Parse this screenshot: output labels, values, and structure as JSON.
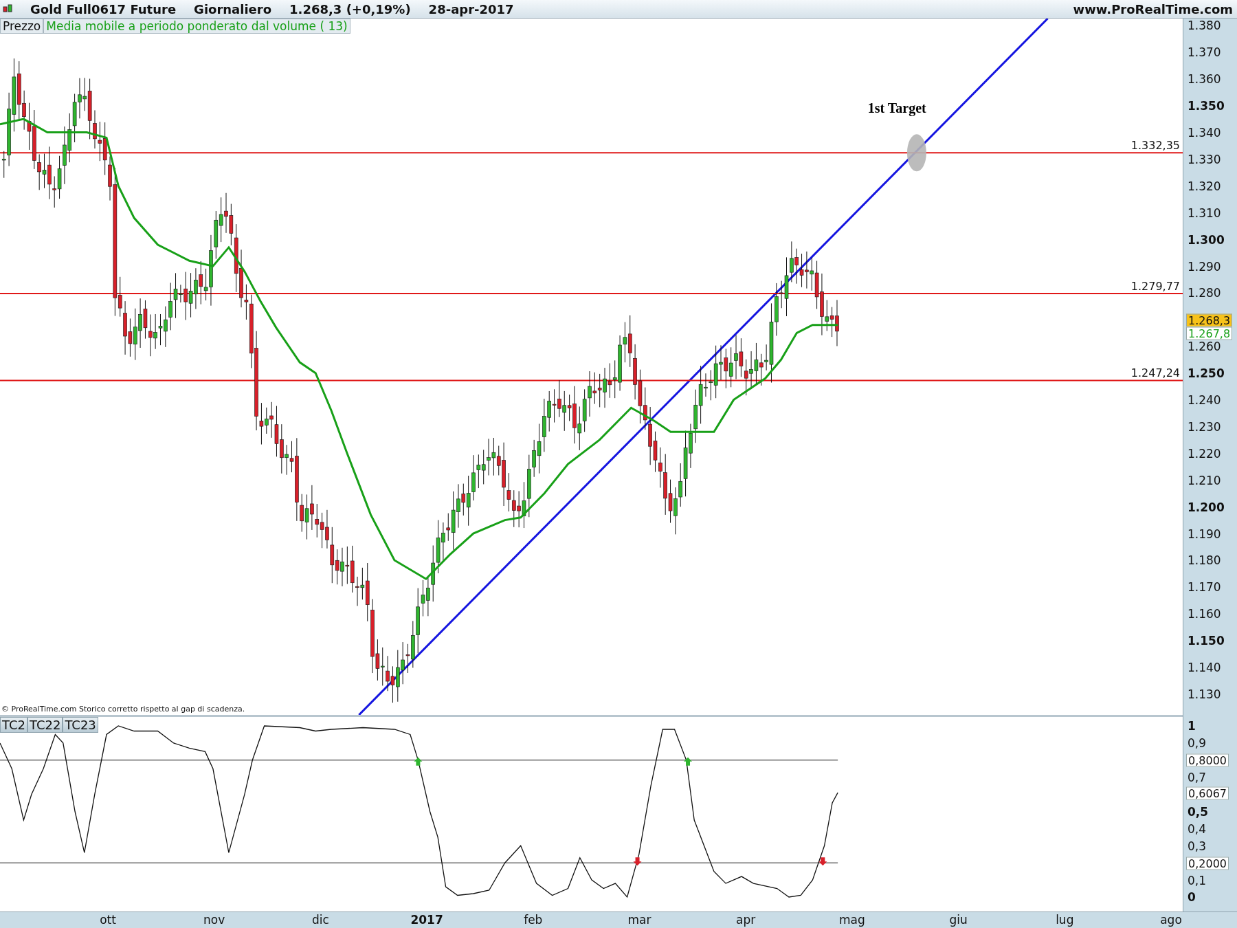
{
  "title_bar": {
    "instrument": "Gold Full0617 Future",
    "period": "Giornaliero",
    "price": "1.268,3 (+0,19%)",
    "date": "28-apr-2017",
    "site": "www.ProRealTime.com"
  },
  "legend": {
    "price_label": "Prezzo",
    "indicator_label": "Media mobile a periodo ponderato dal volume ( 13)"
  },
  "annotation": "1st Target",
  "level_lines": [
    "1.332,35",
    "1.279,77",
    "1.247,24"
  ],
  "price_axis": {
    "ticks": [
      {
        "label": "1.380",
        "bold": false
      },
      {
        "label": "1.370",
        "bold": false
      },
      {
        "label": "1.360",
        "bold": false
      },
      {
        "label": "1.350",
        "bold": true
      },
      {
        "label": "1.340",
        "bold": false
      },
      {
        "label": "1.330",
        "bold": false
      },
      {
        "label": "1.320",
        "bold": false
      },
      {
        "label": "1.310",
        "bold": false
      },
      {
        "label": "1.300",
        "bold": true
      },
      {
        "label": "1.290",
        "bold": false
      },
      {
        "label": "1.280",
        "bold": false
      },
      {
        "label": "1.260",
        "bold": false
      },
      {
        "label": "1.250",
        "bold": true
      },
      {
        "label": "1.240",
        "bold": false
      },
      {
        "label": "1.230",
        "bold": false
      },
      {
        "label": "1.220",
        "bold": false
      },
      {
        "label": "1.210",
        "bold": false
      },
      {
        "label": "1.200",
        "bold": true
      },
      {
        "label": "1.190",
        "bold": false
      },
      {
        "label": "1.180",
        "bold": false
      },
      {
        "label": "1.170",
        "bold": false
      },
      {
        "label": "1.160",
        "bold": false
      },
      {
        "label": "1.150",
        "bold": true
      },
      {
        "label": "1.140",
        "bold": false
      },
      {
        "label": "1.130",
        "bold": false
      }
    ],
    "last_price": "1.268,3",
    "average_value": "1.267,8"
  },
  "footer_note": "© ProRealTime.com  Storico corretto rispetto al gap di scadenza.",
  "indicator_tabs": [
    "TC2",
    "TC22",
    "TC23"
  ],
  "oscillator_axis": {
    "ticks": [
      {
        "label": "1",
        "bold": true
      },
      {
        "label": "0,9",
        "bold": false
      },
      {
        "label": "0,7",
        "bold": false
      },
      {
        "label": "0,5",
        "bold": true
      },
      {
        "label": "0,4",
        "bold": false
      },
      {
        "label": "0,3",
        "bold": false
      },
      {
        "label": "0,1",
        "bold": false
      },
      {
        "label": "0",
        "bold": true
      }
    ],
    "badges": [
      "0,8000",
      "0,6067",
      "0,2000"
    ]
  },
  "time_axis": [
    {
      "label": "ott",
      "bold": false
    },
    {
      "label": "nov",
      "bold": false
    },
    {
      "label": "dic",
      "bold": false
    },
    {
      "label": "2017",
      "bold": true
    },
    {
      "label": "feb",
      "bold": false
    },
    {
      "label": "mar",
      "bold": false
    },
    {
      "label": "apr",
      "bold": false
    },
    {
      "label": "mag",
      "bold": false
    },
    {
      "label": "giu",
      "bold": false
    },
    {
      "label": "lug",
      "bold": false
    },
    {
      "label": "ago",
      "bold": false
    }
  ]
}
